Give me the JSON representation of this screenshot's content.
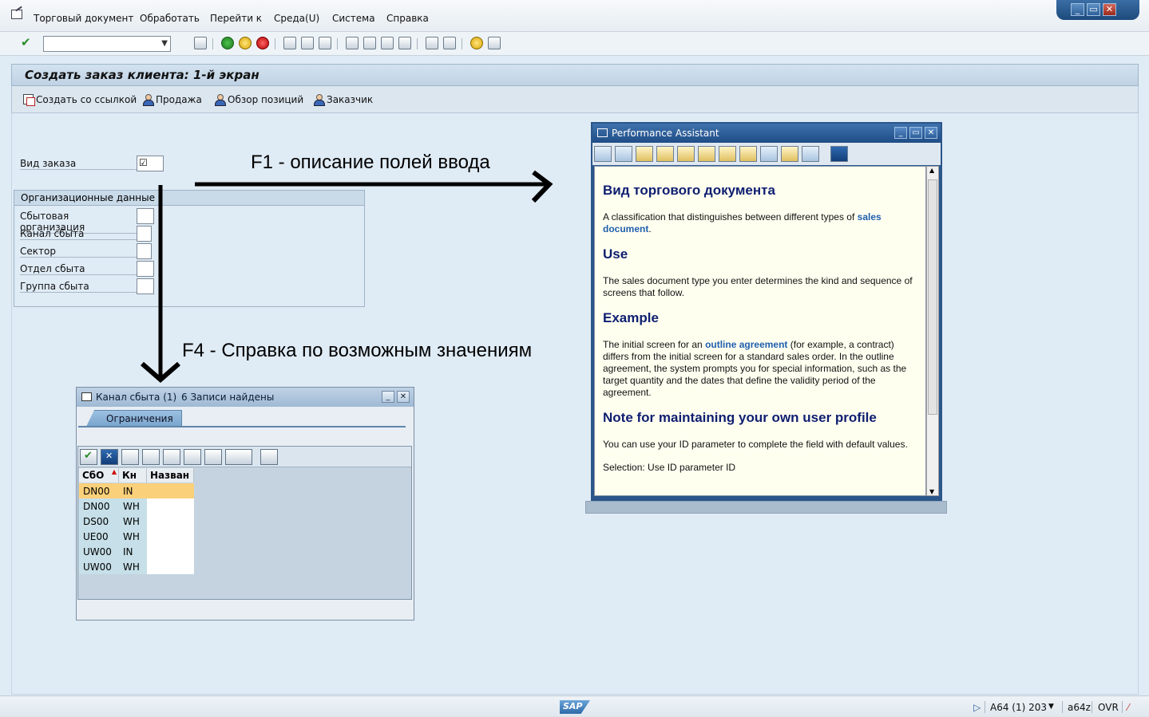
{
  "menu": {
    "items": [
      "Торговый документ",
      "Обработать",
      "Перейти к",
      "Среда(U)",
      "Система",
      "Справка"
    ]
  },
  "window_controls": [
    "_",
    "▭",
    "✕"
  ],
  "toolbar": {
    "command_field_value": ""
  },
  "screen": {
    "title": "Создать заказ клиента: 1-й экран",
    "app_toolbar": [
      {
        "label": "Создать со ссылкой",
        "icon": "document-reference-icon"
      },
      {
        "label": "Продажа",
        "icon": "person-icon"
      },
      {
        "label": "Обзор позиций",
        "icon": "person-icon"
      },
      {
        "label": "Заказчик",
        "icon": "person-icon"
      }
    ]
  },
  "form": {
    "order_type_label": "Вид заказа",
    "order_type_value": "☑",
    "org_group_title": "Организационные данные",
    "org_fields": [
      "Сбытовая организация",
      "Канал сбыта",
      "Сектор",
      "Отдел сбыта",
      "Группа сбыта"
    ]
  },
  "annotations": {
    "f1": "F1 - описание полей ввода",
    "f4": "F4 - Справка по возможным значениям"
  },
  "performance_assistant": {
    "title": "Performance Assistant",
    "heading1": "Вид торгового документа",
    "p1_pre": "A classification that distinguishes between different types of ",
    "p1_link": "sales document",
    "p1_post": ".",
    "heading2": "Use",
    "p2": "The sales document type you enter determines the kind and sequence of screens that follow.",
    "heading3": "Example",
    "p3_pre": "The initial screen for an ",
    "p3_link": "outline agreement",
    "p3_post": " (for example, a contract) differs from the initial screen for a standard sales order. In the outline agreement, the system prompts you for special information, such as the target quantity and the dates that define the validity period of the agreement.",
    "heading4": "Note for maintaining your own user profile",
    "p4": "You can use your ID parameter to complete the field with default values.",
    "p5_partial": "Selection: Use ID parameter ID"
  },
  "f4_popup": {
    "title": "Канал сбыта (1)",
    "records": "6 Записи найдены",
    "tab": "Ограничения",
    "columns": [
      "СбО",
      "Кн",
      "Назван"
    ],
    "rows": [
      [
        "DN00",
        "IN",
        ""
      ],
      [
        "DN00",
        "WH",
        ""
      ],
      [
        "DS00",
        "WH",
        ""
      ],
      [
        "UE00",
        "WH",
        ""
      ],
      [
        "UW00",
        "IN",
        ""
      ],
      [
        "UW00",
        "WH",
        ""
      ]
    ]
  },
  "status": {
    "system": "A64 (1) 203",
    "server": "a64z",
    "mode": "OVR"
  },
  "colors": {
    "background": "#dfebf5",
    "pa_frame": "#2a568a",
    "selected_row": "#fbd07a",
    "link": "#1f5fae",
    "heading": "#0e1e70"
  }
}
